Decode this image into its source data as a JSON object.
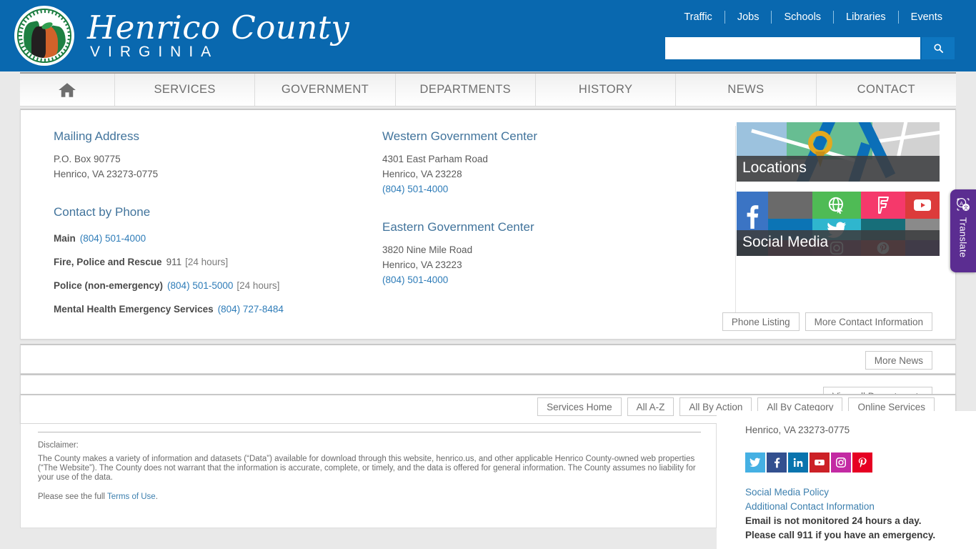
{
  "site": {
    "brand_line1": "Henrico County",
    "brand_line2": "VIRGINIA",
    "seal_alt": "county-seal"
  },
  "header": {
    "accent_blue": "#0968af",
    "search_button_blue": "#0e76c0",
    "toplinks": [
      {
        "label": "Traffic"
      },
      {
        "label": "Jobs"
      },
      {
        "label": "Schools"
      },
      {
        "label": "Libraries"
      },
      {
        "label": "Events"
      }
    ],
    "search": {
      "value": "",
      "placeholder": "",
      "icon": "search-icon"
    }
  },
  "mainnav": {
    "home_icon": "home-icon",
    "items": [
      {
        "label": "SERVICES"
      },
      {
        "label": "GOVERNMENT"
      },
      {
        "label": "DEPARTMENTS"
      },
      {
        "label": "HISTORY"
      },
      {
        "label": "NEWS"
      },
      {
        "label": "CONTACT"
      }
    ]
  },
  "contact": {
    "left": {
      "mailing_heading": "Mailing Address",
      "mailing_line1": "P.O. Box 90775",
      "mailing_line2": "Henrico, VA 23273-0775",
      "phone_heading": "Contact by Phone",
      "phones": [
        {
          "label": "Main",
          "number": "(804) 501-4000",
          "hours": ""
        },
        {
          "label": "Fire, Police and Rescue",
          "number": "",
          "plain": "911",
          "hours": "[24 hours]"
        },
        {
          "label": "Police (non-emergency)",
          "number": "(804) 501-5000",
          "hours": "[24 hours]"
        },
        {
          "label": "Mental Health Emergency Services",
          "number": "(804) 727-8484",
          "hours": ""
        }
      ]
    },
    "mid": {
      "western_heading": "Western Government Center",
      "western_line1": "4301 East Parham Road",
      "western_line2": "Henrico, VA 23228",
      "western_phone": "(804) 501-4000",
      "eastern_heading": "Eastern Government Center",
      "eastern_line1": "3820 Nine Mile Road",
      "eastern_line2": "Henrico, VA 23223",
      "eastern_phone": "(804) 501-4000"
    },
    "tiles": [
      {
        "caption": "Locations",
        "name": "tile-locations"
      },
      {
        "caption": "Social Media",
        "name": "tile-social"
      }
    ],
    "buttons": [
      {
        "label": "Phone Listing"
      },
      {
        "label": "More Contact Information"
      }
    ]
  },
  "news": {
    "buttons": [
      {
        "label": "More News"
      }
    ]
  },
  "departments": {
    "buttons": [
      {
        "label": "View all Departments"
      }
    ]
  },
  "services": {
    "buttons": [
      {
        "label": "Services Home"
      },
      {
        "label": "All A-Z"
      },
      {
        "label": "All By Action"
      },
      {
        "label": "All By Category"
      },
      {
        "label": "Online Services"
      }
    ]
  },
  "footer": {
    "disclaimer_title": "Disclaimer:",
    "disclaimer_body": "The County makes a variety of information and datasets (“Data”) available for download through this website, henrico.us, and other applicable Henrico County-owned web properties (“The Website”). The County does not warrant that the information is accurate, complete, or timely, and the data is offered for general information. The County assumes no liability for your use of the data.",
    "terms_prefix": "Please see the full ",
    "terms_link": "Terms of Use",
    "terms_suffix": ".",
    "address_line": "Henrico, VA 23273-0775",
    "social": [
      {
        "name": "twitter-icon",
        "color": "#45b0e3"
      },
      {
        "name": "facebook-icon",
        "color": "#33508f"
      },
      {
        "name": "linkedin-icon",
        "color": "#0a74ae"
      },
      {
        "name": "youtube-icon",
        "color": "#cc2127"
      },
      {
        "name": "instagram-icon",
        "color": "#c32aa3"
      },
      {
        "name": "pinterest-icon",
        "color": "#e60023"
      }
    ],
    "links": [
      {
        "label": "Social Media Policy"
      },
      {
        "label": "Additional Contact Information"
      }
    ],
    "notice_line1": "Email is not monitored 24 hours a day.",
    "notice_line2": "Please call 911 if you have an emergency."
  },
  "translate": {
    "label": "Translate",
    "icon": "translate-icon",
    "color": "#5b2d91"
  }
}
